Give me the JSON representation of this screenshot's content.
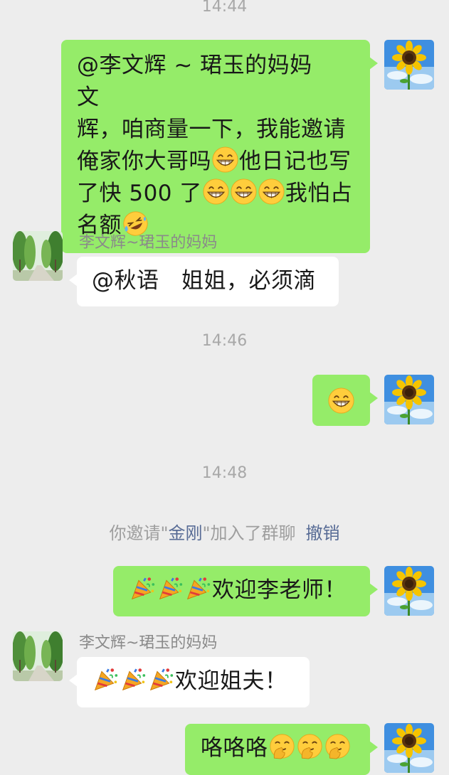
{
  "timestamps": {
    "t1": "14:44",
    "t2": "14:46",
    "t3": "14:48"
  },
  "names": {
    "contact": "李文辉~珺玉的妈妈"
  },
  "messages": {
    "m1": {
      "line1": "@李文辉 ~ 珺玉的妈妈　文",
      "line2": "辉，咱商量一下，我能邀请",
      "line3a": "俺家你大哥吗",
      "line3b": "他日记也写",
      "line4a": "了快 500 了",
      "line4b": "我怕占",
      "line5": "名额"
    },
    "m2": {
      "text": "@秋语　姐姐，必须滴"
    },
    "m4": {
      "text": "欢迎李老师！"
    },
    "m5": {
      "text": "欢迎姐夫！"
    },
    "m6": {
      "text": "咯咯咯"
    }
  },
  "system": {
    "prefix": "你邀请\"",
    "invitee": "金刚",
    "suffix": "\"加入了群聊",
    "revoke": "撤销"
  },
  "emoji_names": [
    "grin-emoji",
    "rofl-emoji",
    "party-popper-emoji",
    "shush-emoji"
  ],
  "colors": {
    "background": "#ededed",
    "outgoing_bubble": "#95ec69",
    "incoming_bubble": "#ffffff",
    "link": "#576b95",
    "timestamp": "#a8a8a8"
  }
}
